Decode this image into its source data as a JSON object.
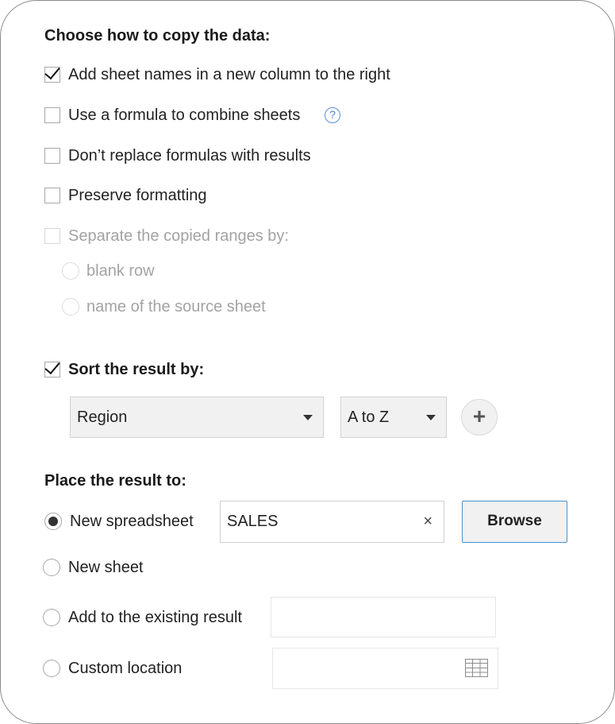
{
  "copy_section": {
    "heading": "Choose how to copy the data:",
    "options": [
      {
        "label": "Add sheet names in a new column to the right",
        "checked": true
      },
      {
        "label": "Use a formula to combine sheets",
        "checked": false,
        "help_icon": "question-circle-icon"
      },
      {
        "label": "Don’t replace formulas with results",
        "checked": false
      },
      {
        "label": "Preserve formatting",
        "checked": false
      }
    ],
    "separate": {
      "label": "Separate the copied ranges by:",
      "checked": false,
      "disabled": true,
      "choices": [
        "blank row",
        "name of the source sheet"
      ]
    }
  },
  "sort_section": {
    "label": "Sort the result by:",
    "checked": true,
    "column_select": "Region",
    "order_select": "A to Z",
    "add_button": "+"
  },
  "place_section": {
    "heading": "Place the result to:",
    "new_spreadsheet": {
      "label": "New spreadsheet",
      "selected": true,
      "name_value": "SALES",
      "clear_icon": "×",
      "browse_label": "Browse"
    },
    "new_sheet": {
      "label": "New sheet",
      "selected": false
    },
    "existing_result": {
      "label": "Add to the existing result",
      "selected": false
    },
    "custom_location": {
      "label": "Custom location",
      "selected": false,
      "icon": "grid-range-icon"
    }
  },
  "colors": {
    "accent_border": "#4a90c8",
    "help_icon": "#5b8fd6",
    "disabled_text": "#a3a3a3"
  }
}
